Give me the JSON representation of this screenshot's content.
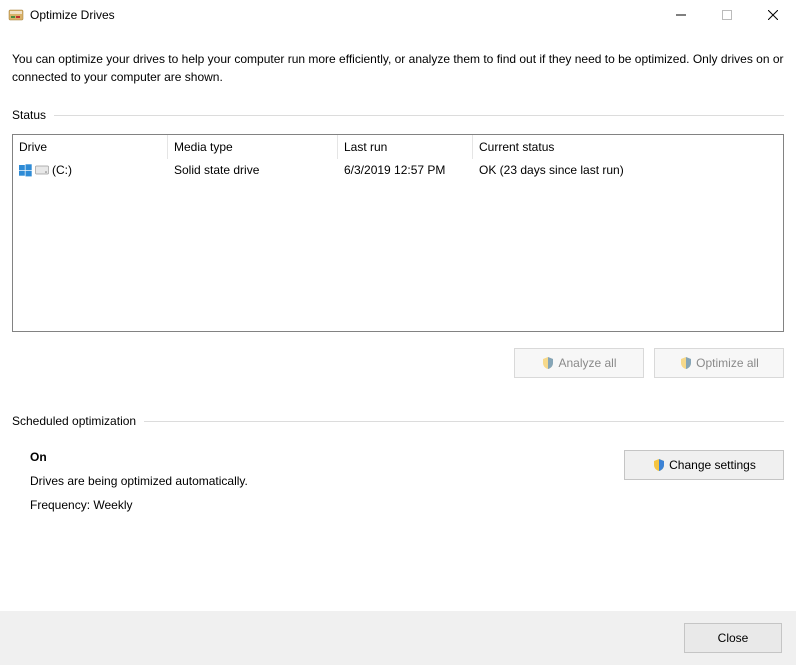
{
  "window": {
    "title": "Optimize Drives"
  },
  "intro": "You can optimize your drives to help your computer run more efficiently, or analyze them to find out if they need to be optimized. Only drives on or connected to your computer are shown.",
  "status": {
    "section_label": "Status",
    "columns": {
      "drive": "Drive",
      "media": "Media type",
      "last": "Last run",
      "status": "Current status"
    },
    "rows": [
      {
        "drive": "(C:)",
        "media": "Solid state drive",
        "last": "6/3/2019 12:57 PM",
        "status": "OK (23 days since last run)"
      }
    ]
  },
  "actions": {
    "analyze": "Analyze all",
    "optimize": "Optimize all"
  },
  "scheduled": {
    "section_label": "Scheduled optimization",
    "state": "On",
    "desc": "Drives are being optimized automatically.",
    "freq": "Frequency: Weekly",
    "change": "Change settings"
  },
  "footer": {
    "close": "Close"
  }
}
